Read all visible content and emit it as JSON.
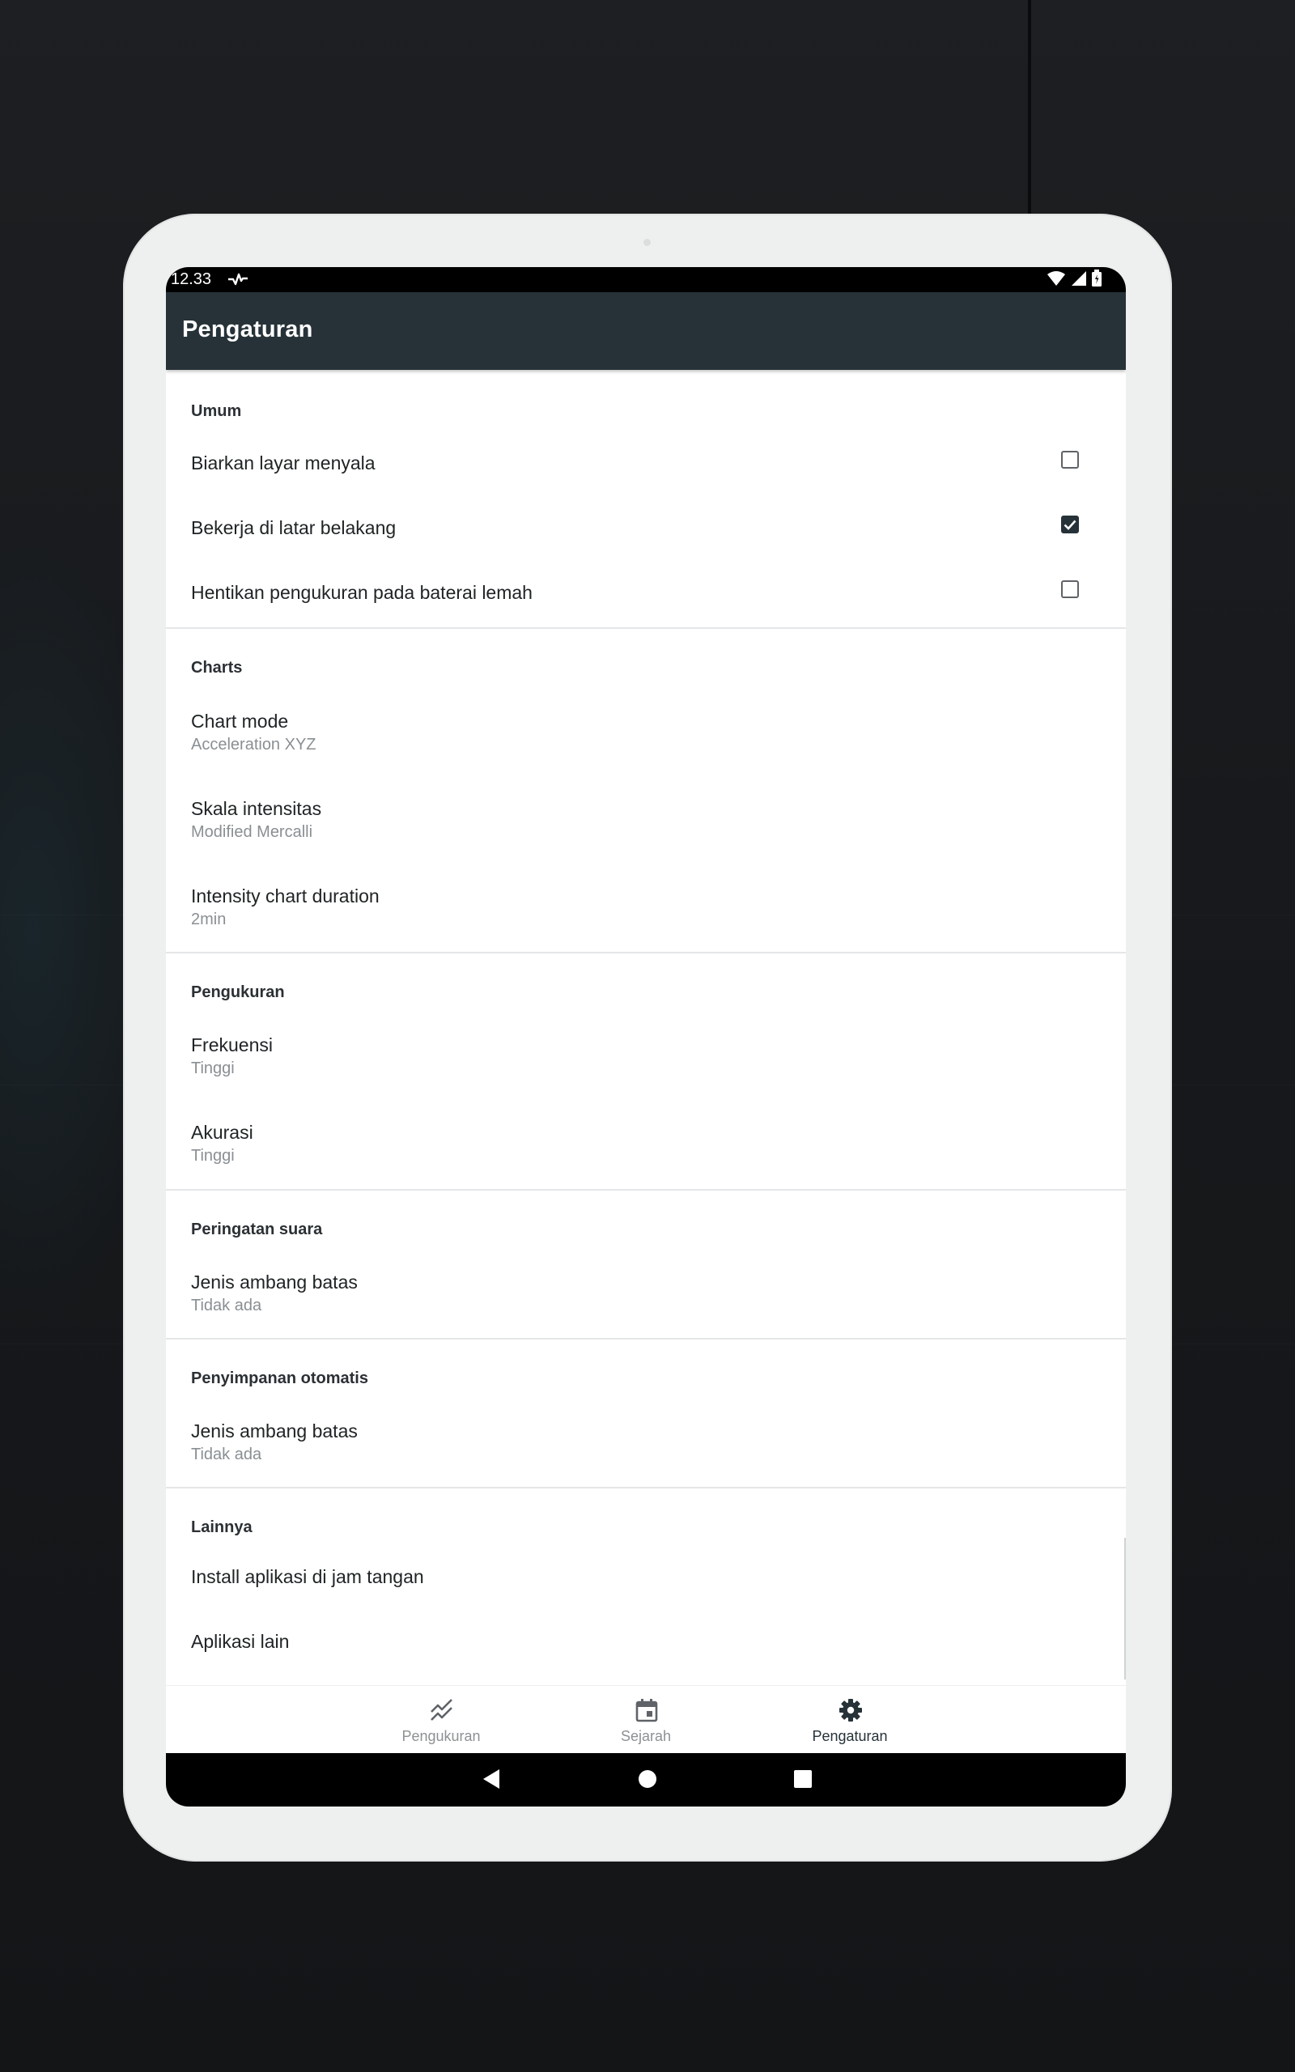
{
  "status_bar": {
    "time": "12.33",
    "activity_icon": "pulse-icon",
    "wifi_icon": "wifi-icon",
    "signal_icon": "signal-icon",
    "battery_icon": "battery-icon"
  },
  "app_bar": {
    "title": "Pengaturan"
  },
  "sections": {
    "umum": {
      "title": "Umum",
      "items": [
        {
          "label": "Biarkan layar menyala",
          "checked": false
        },
        {
          "label": "Bekerja di latar belakang",
          "checked": true
        },
        {
          "label": "Hentikan pengukuran pada baterai lemah",
          "checked": false
        }
      ]
    },
    "charts": {
      "title": "Charts",
      "items": [
        {
          "label": "Chart mode",
          "value": "Acceleration XYZ"
        },
        {
          "label": "Skala intensitas",
          "value": "Modified Mercalli"
        },
        {
          "label": "Intensity chart duration",
          "value": "2min"
        }
      ]
    },
    "pengukuran": {
      "title": "Pengukuran",
      "items": [
        {
          "label": "Frekuensi",
          "value": "Tinggi"
        },
        {
          "label": "Akurasi",
          "value": "Tinggi"
        }
      ]
    },
    "peringatan": {
      "title": "Peringatan suara",
      "items": [
        {
          "label": "Jenis ambang batas",
          "value": "Tidak ada"
        }
      ]
    },
    "penyimpanan": {
      "title": "Penyimpanan otomatis",
      "items": [
        {
          "label": "Jenis ambang batas",
          "value": "Tidak ada"
        }
      ]
    },
    "lainnya": {
      "title": "Lainnya",
      "items": [
        {
          "label": "Install aplikasi di jam tangan"
        },
        {
          "label": "Aplikasi lain"
        }
      ]
    }
  },
  "bottom_nav": {
    "items": [
      {
        "label": "Pengukuran",
        "icon": "chart-line-icon",
        "active": false
      },
      {
        "label": "Sejarah",
        "icon": "calendar-icon",
        "active": false
      },
      {
        "label": "Pengaturan",
        "icon": "gear-icon",
        "active": true
      }
    ]
  },
  "system_nav": {
    "back_icon": "back-triangle-icon",
    "home_icon": "home-circle-icon",
    "recents_icon": "recents-square-icon"
  },
  "colors": {
    "app_bar": "#263238",
    "checkbox_checked": "#263238",
    "background": "#17191c",
    "device_frame": "#eeefef"
  }
}
